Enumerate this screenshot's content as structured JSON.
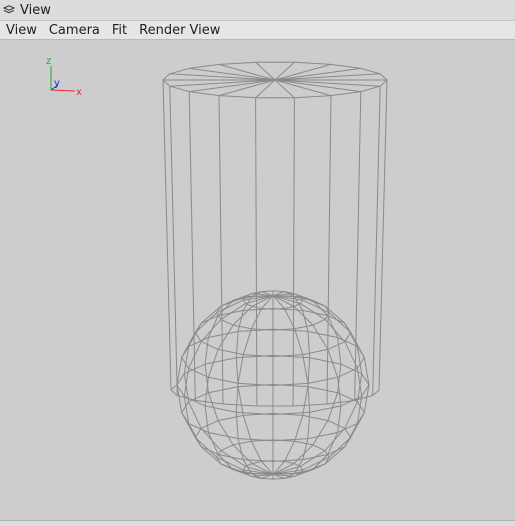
{
  "window": {
    "title": "View",
    "title_icon": "eye-icon"
  },
  "menu": {
    "items": [
      {
        "label": "View"
      },
      {
        "label": "Camera"
      },
      {
        "label": "Fit"
      },
      {
        "label": "Render View"
      }
    ]
  },
  "viewport": {
    "background": "#cdcdcd",
    "wire_color": "#8a8a8a",
    "axis_triad": {
      "x_label": "x",
      "y_label": "y",
      "z_label": "z",
      "x_color": "#e03030",
      "y_color": "#2030d0",
      "z_color": "#20b020"
    },
    "objects": [
      {
        "kind": "cylinder",
        "name": "wireframe-cylinder",
        "segments": 18
      },
      {
        "kind": "sphere",
        "name": "wireframe-sphere",
        "segments": 16,
        "rings": 10
      }
    ]
  }
}
